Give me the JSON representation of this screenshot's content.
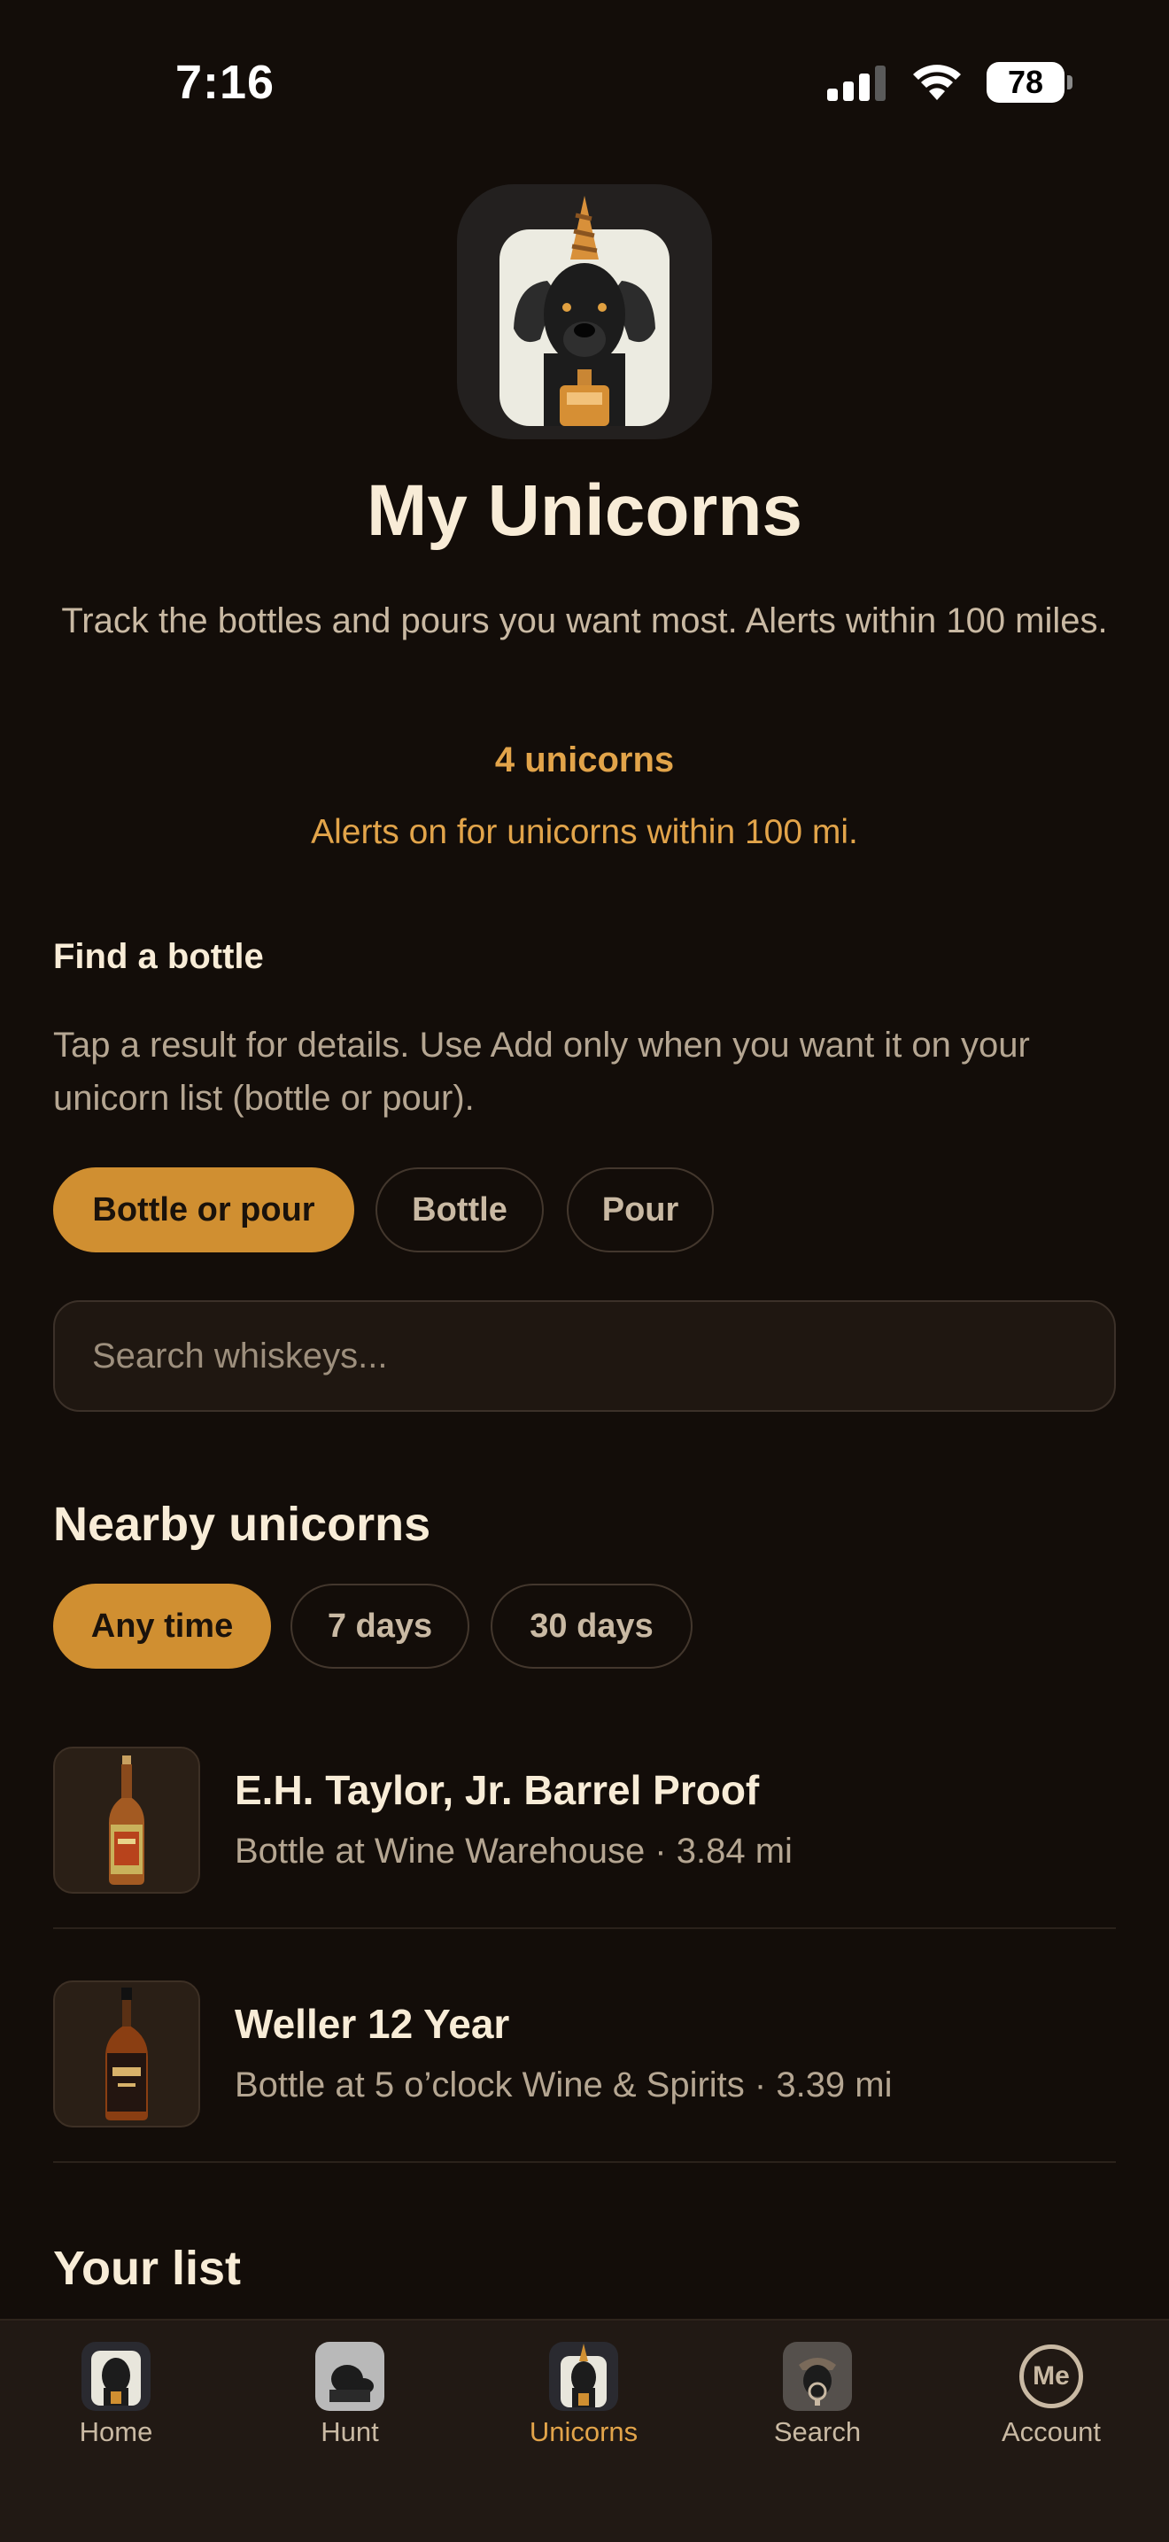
{
  "status_bar": {
    "time": "7:16",
    "battery": "78"
  },
  "header": {
    "title": "My Unicorns",
    "subtitle": "Track the bottles and pours you want most. Alerts within 100 miles.",
    "count": "4 unicorns",
    "alerts_note": "Alerts on for unicorns within 100 mi."
  },
  "find": {
    "heading": "Find a bottle",
    "help": "Tap a result for details. Use Add only when you want it on your unicorn list (bottle or pour).",
    "filters": [
      "Bottle or pour",
      "Bottle",
      "Pour"
    ],
    "selected_filter": "Bottle or pour",
    "search_placeholder": "Search whiskeys...",
    "search_value": ""
  },
  "nearby": {
    "heading": "Nearby unicorns",
    "time_filters": [
      "Any time",
      "7 days",
      "30 days"
    ],
    "selected_time": "Any time",
    "items": [
      {
        "name": "E.H. Taylor, Jr. Barrel Proof",
        "detail": "Bottle at Wine Warehouse · 3.84 mi"
      },
      {
        "name": "Weller 12 Year",
        "detail": "Bottle at 5 o’clock Wine & Spirits · 3.39 mi"
      }
    ]
  },
  "your_list": {
    "heading": "Your list"
  },
  "tab_bar": {
    "tabs": [
      {
        "label": "Home",
        "icon": "dog-logo-icon"
      },
      {
        "label": "Hunt",
        "icon": "dog-tracking-icon"
      },
      {
        "label": "Unicorns",
        "icon": "unicorn-dog-icon"
      },
      {
        "label": "Search",
        "icon": "dog-magnifier-icon"
      },
      {
        "label": "Account",
        "icon": "me-avatar-icon"
      }
    ],
    "active": "Unicorns",
    "account_initials": "Me"
  },
  "colors": {
    "background": "#130d09",
    "accent": "#d08f31",
    "accent_text": "#e2a44a",
    "tab_bar": "#211914"
  }
}
